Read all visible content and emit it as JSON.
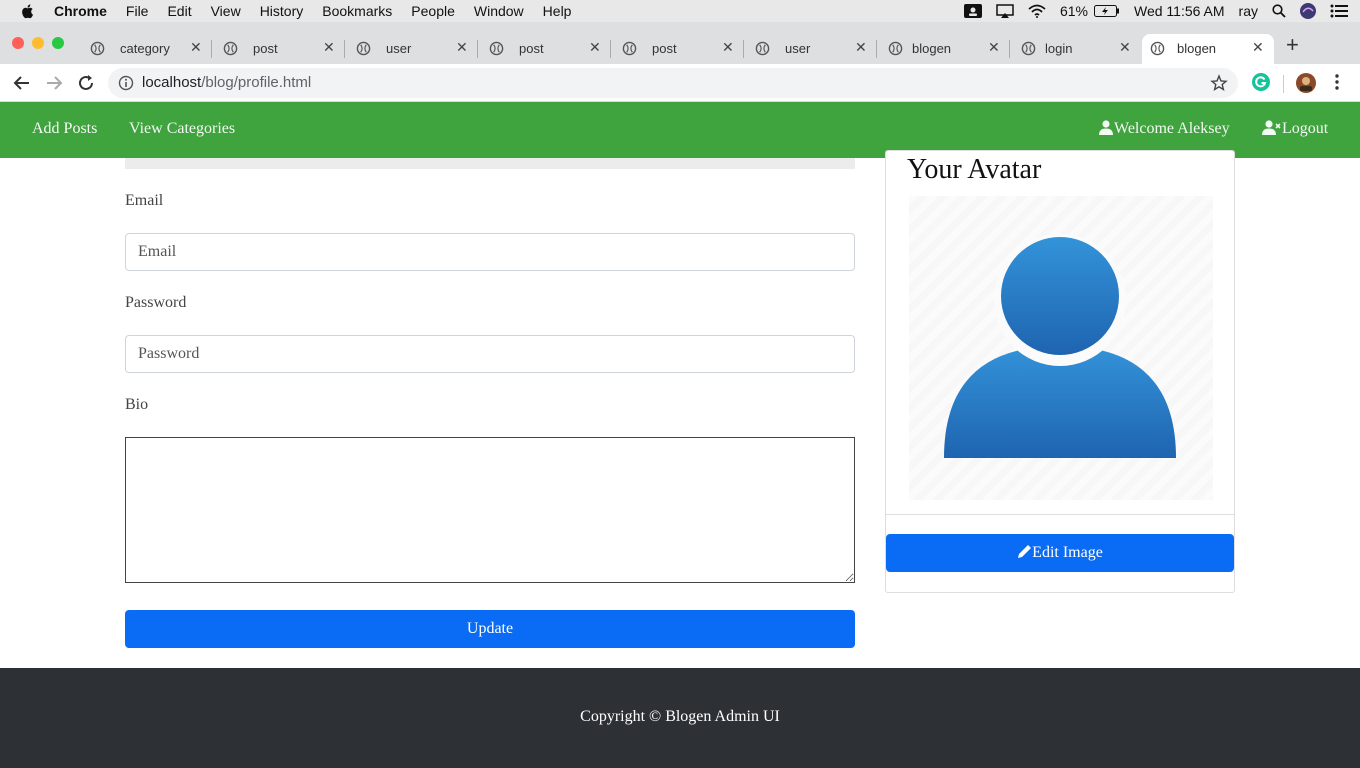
{
  "menubar": {
    "app": "Chrome",
    "items": [
      "File",
      "Edit",
      "View",
      "History",
      "Bookmarks",
      "People",
      "Window",
      "Help"
    ],
    "battery": "61%",
    "clock": "Wed 11:56 AM",
    "user": "ray"
  },
  "tabs": [
    {
      "label": "category"
    },
    {
      "label": "post"
    },
    {
      "label": "user"
    },
    {
      "label": "post"
    },
    {
      "label": "post"
    },
    {
      "label": "user"
    },
    {
      "label": "blogen"
    },
    {
      "label": "login"
    },
    {
      "label": "blogen",
      "active": true
    }
  ],
  "address": {
    "host": "localhost",
    "path": "/blog/profile.html"
  },
  "navbar": {
    "add_posts": "Add Posts",
    "view_categories": "View Categories",
    "welcome": "Welcome Aleksey",
    "logout": "Logout"
  },
  "form": {
    "email_label": "Email",
    "email_placeholder": "Email",
    "email_value": "",
    "password_label": "Password",
    "password_placeholder": "Password",
    "password_value": "",
    "bio_label": "Bio",
    "bio_value": "",
    "update_button": "Update"
  },
  "avatar_card": {
    "title": "Your Avatar",
    "edit_button": "Edit Image"
  },
  "footer": {
    "copyright": "Copyright © Blogen Admin UI"
  },
  "colors": {
    "navbar": "#3fa33e",
    "primary": "#0a6cf5",
    "footer": "#2d3136"
  }
}
